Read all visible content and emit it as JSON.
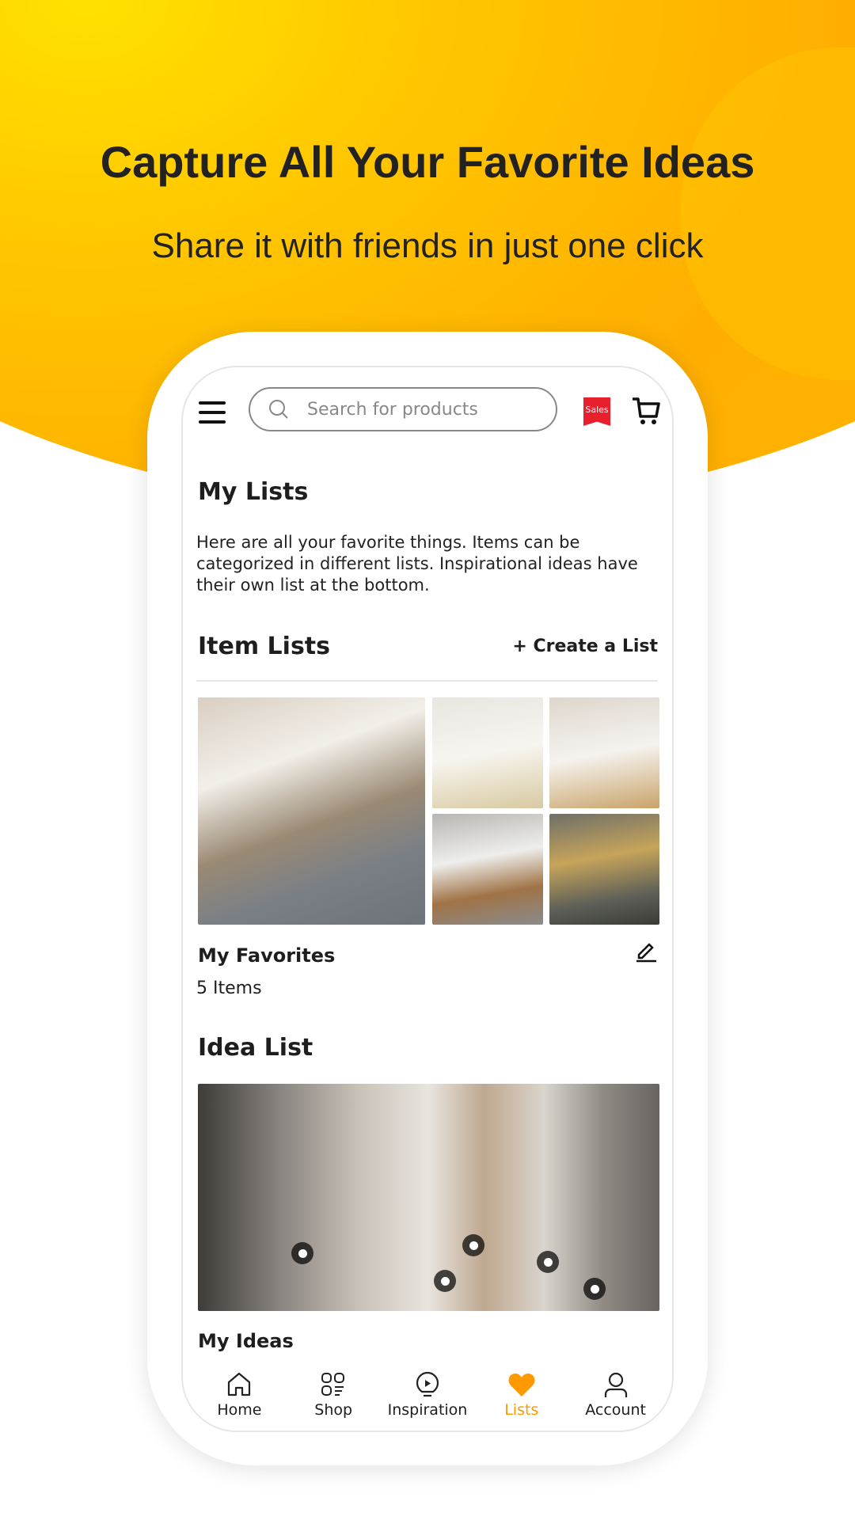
{
  "hero": {
    "title": "Capture All Your Favorite Ideas",
    "subtitle": "Share it with friends in just one click"
  },
  "header": {
    "search_placeholder": "Search for products",
    "sales_badge": "Sales"
  },
  "my_lists": {
    "title": "My Lists",
    "description": "Here are all your favorite things. Items can be categorized in different lists. Inspirational ideas have their own list at the bottom."
  },
  "item_lists": {
    "title": "Item Lists",
    "create_label": "+ Create a List",
    "list": {
      "name": "My Favorites",
      "count": "5 Items"
    }
  },
  "idea_list": {
    "title": "Idea List",
    "list": {
      "name": "My Ideas"
    }
  },
  "nav": [
    {
      "label": "Home",
      "icon": "home-icon"
    },
    {
      "label": "Shop",
      "icon": "shop-icon"
    },
    {
      "label": "Inspiration",
      "icon": "bulb-play-icon"
    },
    {
      "label": "Lists",
      "icon": "heart-icon",
      "active": true
    },
    {
      "label": "Account",
      "icon": "user-icon"
    }
  ],
  "colors": {
    "accent": "#ff9900",
    "sales": "#e8202e",
    "hero_bg": "#ffb300"
  }
}
